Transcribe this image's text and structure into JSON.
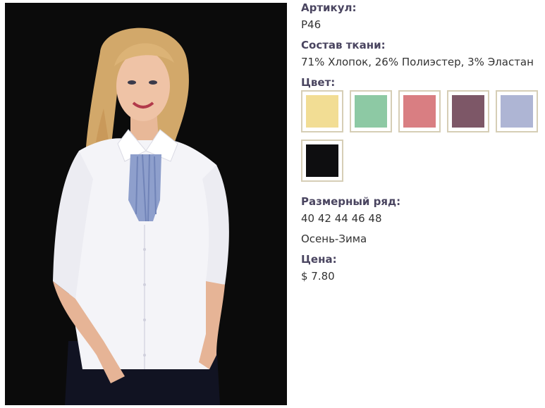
{
  "product": {
    "article_label": "Артикул:",
    "article_value": "P46",
    "fabric_label": "Состав ткани:",
    "fabric_value": "71% Хлопок, 26% Полиэстер, 3% Эластан",
    "color_label": "Цвет:",
    "colors": [
      {
        "name": "yellow",
        "hex": "#f2dd94"
      },
      {
        "name": "green",
        "hex": "#8dc9a4"
      },
      {
        "name": "pink",
        "hex": "#d97e82"
      },
      {
        "name": "plum",
        "hex": "#7d5767"
      },
      {
        "name": "light-blue",
        "hex": "#aeb5d4"
      },
      {
        "name": "black",
        "hex": "#0e0e10"
      }
    ],
    "sizes_label": "Размерный ряд:",
    "sizes_value": "40 42 44 46 48",
    "season_value": "Осень-Зима",
    "price_label": "Цена:",
    "price_value": "$ 7.80"
  },
  "photo": {
    "subject": "model-in-white-blouse-with-blue-tie",
    "background_color": "#0b0b0b"
  },
  "theme": {
    "label_color": "#4a4560",
    "swatch_border": "#d6ceb6"
  }
}
